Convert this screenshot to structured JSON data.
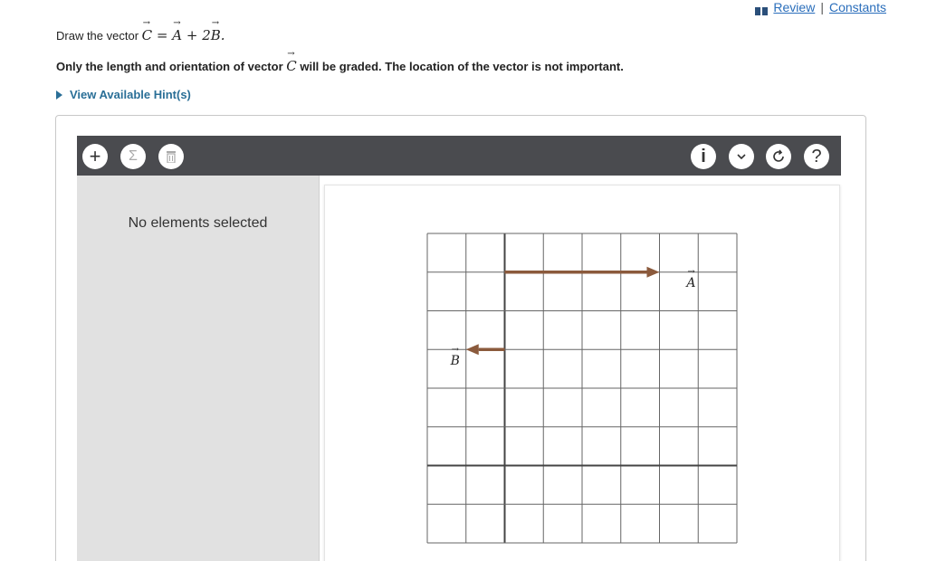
{
  "header_links": {
    "review": "Review",
    "separator": "|",
    "constants": "Constants"
  },
  "prompt": {
    "prefix": "Draw the vector",
    "equation_parts": [
      "C",
      " = ",
      "A",
      " + 2",
      "B",
      "."
    ]
  },
  "instruction_parts": [
    "Only the length and orientation of vector ",
    "C",
    " will be graded. The location of the vector is not important."
  ],
  "hint": {
    "label": "View Available Hint(s)"
  },
  "toolbar": {
    "left_tools": [
      {
        "name": "add-tool-button",
        "icon": "plus-icon",
        "glyph": "+"
      },
      {
        "name": "sum-tool-button",
        "icon": "sigma-icon",
        "glyph": "Σ"
      },
      {
        "name": "delete-tool-button",
        "icon": "trash-icon",
        "glyph": ""
      }
    ],
    "right_tools": [
      {
        "name": "info-button",
        "icon": "info-icon",
        "glyph": "i"
      },
      {
        "name": "dropdown-button",
        "icon": "chevron-down-icon",
        "glyph": "⌄"
      },
      {
        "name": "reset-button",
        "icon": "reset-icon",
        "glyph": "↻"
      },
      {
        "name": "help-button",
        "icon": "help-icon",
        "glyph": "?"
      }
    ]
  },
  "side_panel": {
    "message": "No elements selected"
  },
  "grid": {
    "columns": 8,
    "rows": 8,
    "axis_col": 2,
    "axis_row": 6,
    "vectors": [
      {
        "label": "A",
        "from": [
          2,
          1
        ],
        "to": [
          6,
          1
        ],
        "color": "#8b5a3c"
      },
      {
        "label": "B",
        "from": [
          2,
          3
        ],
        "to": [
          1,
          3
        ],
        "color": "#8b5a3c"
      }
    ]
  }
}
